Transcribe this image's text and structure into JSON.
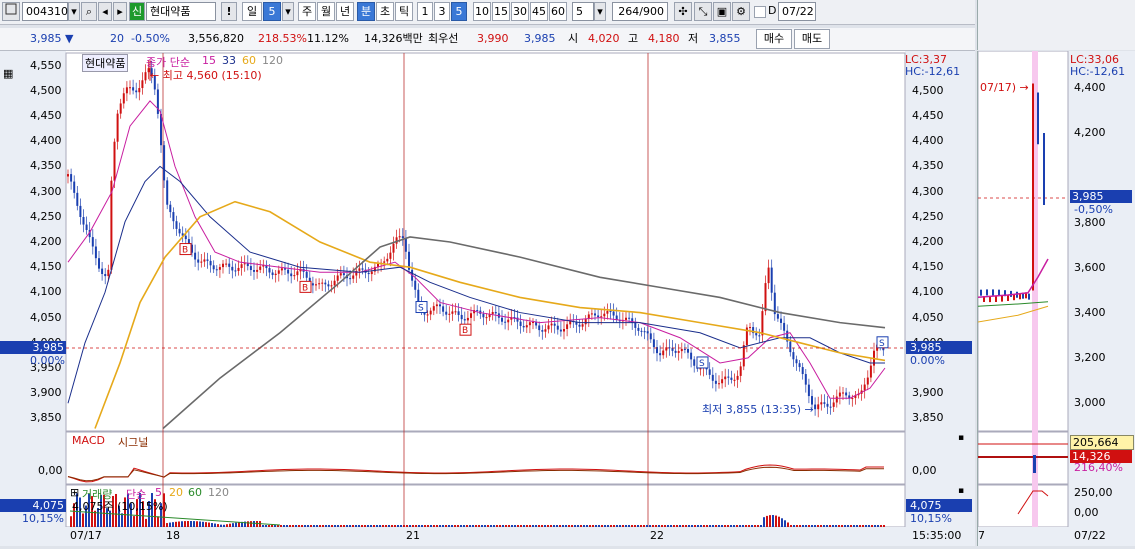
{
  "toolbar": {
    "code": "004310",
    "stock_name": "현대약품",
    "badge": "신",
    "bang": "!",
    "periods": [
      "일",
      "5",
      "주",
      "월",
      "년",
      "분",
      "초",
      "틱"
    ],
    "minutes": [
      "1",
      "3",
      "5",
      "10",
      "15",
      "30",
      "45",
      "60"
    ],
    "interval_value": "5",
    "count": "264/900",
    "date_checkbox_label": "D",
    "date_value": "07/22"
  },
  "quote": {
    "price": "3,985",
    "arrow": "▼",
    "change": "20",
    "change_pct": "-0.50%",
    "volume": "3,556,820",
    "vol_ratio": "218.53%",
    "turnover": "11.12%",
    "amount": "14,326백만",
    "prefer_label": "최우선",
    "bid1": "3,990",
    "bid2": "3,985",
    "open_label": "시",
    "open": "4,020",
    "high_label": "고",
    "high": "4,180",
    "low_label": "저",
    "low": "3,855",
    "buy_label": "매수",
    "sell_label": "매도"
  },
  "price_panel": {
    "title": "현대약품",
    "ma_label": "종가 단순",
    "ma_periods": [
      "15",
      "33",
      "60",
      "120"
    ],
    "high_note": "최고 4,560 (15:10)",
    "low_note": "최저 3,855 (13:35)",
    "lc": "LC:3,37",
    "hc": "HC:-12,61",
    "y_ticks": [
      "4,550",
      "4,500",
      "4,450",
      "4,400",
      "4,350",
      "4,300",
      "4,250",
      "4,200",
      "4,150",
      "4,100",
      "4,050",
      "4,000",
      "3,950",
      "3,900",
      "3,850"
    ],
    "y_ticks_right": [
      "4,500",
      "4,450",
      "4,400",
      "4,350",
      "4,300",
      "4,250",
      "4,200",
      "4,150",
      "4,100",
      "4,050",
      "4,000",
      "3,900",
      "3,850"
    ],
    "current_price": "3,985",
    "current_pct": "0.00%"
  },
  "macd_panel": {
    "label": "MACD",
    "signal_label": "시그널",
    "zero": "0,00"
  },
  "volume_panel": {
    "label": "거래량",
    "ma_label": "단순",
    "ma_periods": [
      "5",
      "20",
      "60",
      "120"
    ],
    "value_note": "4,075주 (10,15%)",
    "left_value": "4,075",
    "left_pct": "10,15%",
    "right_value": "4,075",
    "right_pct": "10,15%"
  },
  "x_axis": {
    "labels": [
      "07/17",
      "18",
      "21",
      "22"
    ],
    "end_time": "15:35:00"
  },
  "right_panel": {
    "lc": "LC:33,06",
    "hc": "HC:-12,61",
    "date_note": "07/17)",
    "y_ticks": [
      "4,400",
      "4,200",
      "3,800",
      "3,600",
      "3,400",
      "3,200",
      "3,000"
    ],
    "current": "3,985",
    "current_pct": "-0,50%",
    "macd_value": "205,664",
    "macd_amount": "14,326",
    "macd_pct": "216,40%",
    "vol_ticks": [
      "250,00",
      "0,00"
    ],
    "x_labels": [
      "7",
      "07/22"
    ]
  },
  "colors": {
    "up": "#d01010",
    "down": "#1a3fb0",
    "ma15": "#c81ea0",
    "ma33": "#1a2e8c",
    "ma60": "#e6a91a",
    "ma120": "#6a6a6a",
    "selected": "#3a78d6"
  }
}
